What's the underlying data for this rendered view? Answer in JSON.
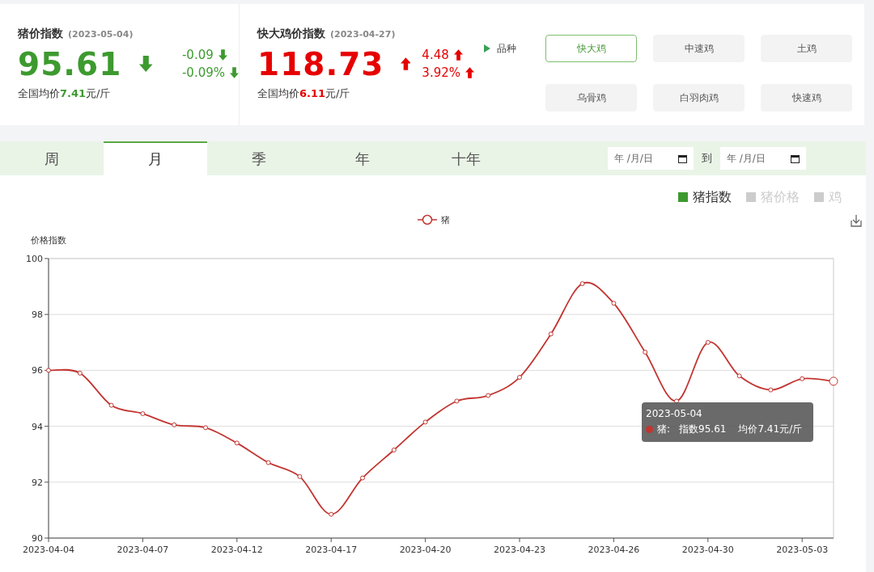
{
  "indices": [
    {
      "title": "猪价指数",
      "date": "(2023-05-04)",
      "value": "95.61",
      "kind": "down",
      "change": "-0.09",
      "change_pct": "-0.09%",
      "avg_price": "全国均价**7.41**元/斤"
    },
    {
      "title": "快大鸡价指数",
      "date": "(2023-04-27)",
      "value": "118.73",
      "kind": "up",
      "change": "4.48",
      "change_pct": "3.92%",
      "avg_price": "全国均价**6.11**元/斤"
    }
  ],
  "variety": {
    "label": "品种",
    "options": [
      {
        "label": "快大鸡",
        "selected": true
      },
      {
        "label": "中速鸡",
        "selected": false
      },
      {
        "label": "土鸡",
        "selected": false
      },
      {
        "label": "乌骨鸡",
        "selected": false
      },
      {
        "label": "白羽肉鸡",
        "selected": false
      },
      {
        "label": "快速鸡",
        "selected": false
      }
    ]
  },
  "period_tabs": [
    {
      "label": "周",
      "selected": false
    },
    {
      "label": "月",
      "selected": true
    },
    {
      "label": "季",
      "selected": false
    },
    {
      "label": "年",
      "selected": false
    },
    {
      "label": "十年",
      "selected": false
    }
  ],
  "date_range": {
    "start_placeholder": "年 /月/日",
    "separator": "到",
    "end_placeholder": "年 /月/日"
  },
  "series_toggles": [
    {
      "label": "猪指数",
      "selected": true
    },
    {
      "label": "猪价格",
      "selected": false
    },
    {
      "label": "鸡",
      "selected": false
    }
  ],
  "chart": {
    "chart_data": {
      "type": "line",
      "ylabel": "价格指数",
      "categories": [
        "2023-04-04",
        null,
        null,
        "2023-04-07",
        null,
        null,
        "2023-04-12",
        null,
        null,
        "2023-04-17",
        null,
        null,
        "2023-04-20",
        null,
        null,
        "2023-04-23",
        null,
        null,
        "2023-04-26",
        null,
        null,
        "2023-04-30",
        null,
        null,
        "2023-05-03",
        null
      ],
      "grid": true,
      "series": [
        {
          "name": "猪",
          "color": "#c23531",
          "marker": "circle",
          "values": [
            96.0,
            95.9,
            94.75,
            94.45,
            94.05,
            93.95,
            93.4,
            92.7,
            92.2,
            90.85,
            92.15,
            93.15,
            94.15,
            94.9,
            95.1,
            95.75,
            97.3,
            99.1,
            98.4,
            96.65,
            94.9,
            97.0,
            95.8,
            95.3,
            95.7,
            95.61
          ]
        }
      ],
      "ylim": [
        90,
        100
      ],
      "yticks": [
        90,
        92,
        94,
        96,
        98,
        100
      ]
    },
    "tooltip": {
      "date": "2023-05-04",
      "series": "猪:",
      "index": "指数95.61",
      "price": "均价7.41元/斤"
    }
  }
}
